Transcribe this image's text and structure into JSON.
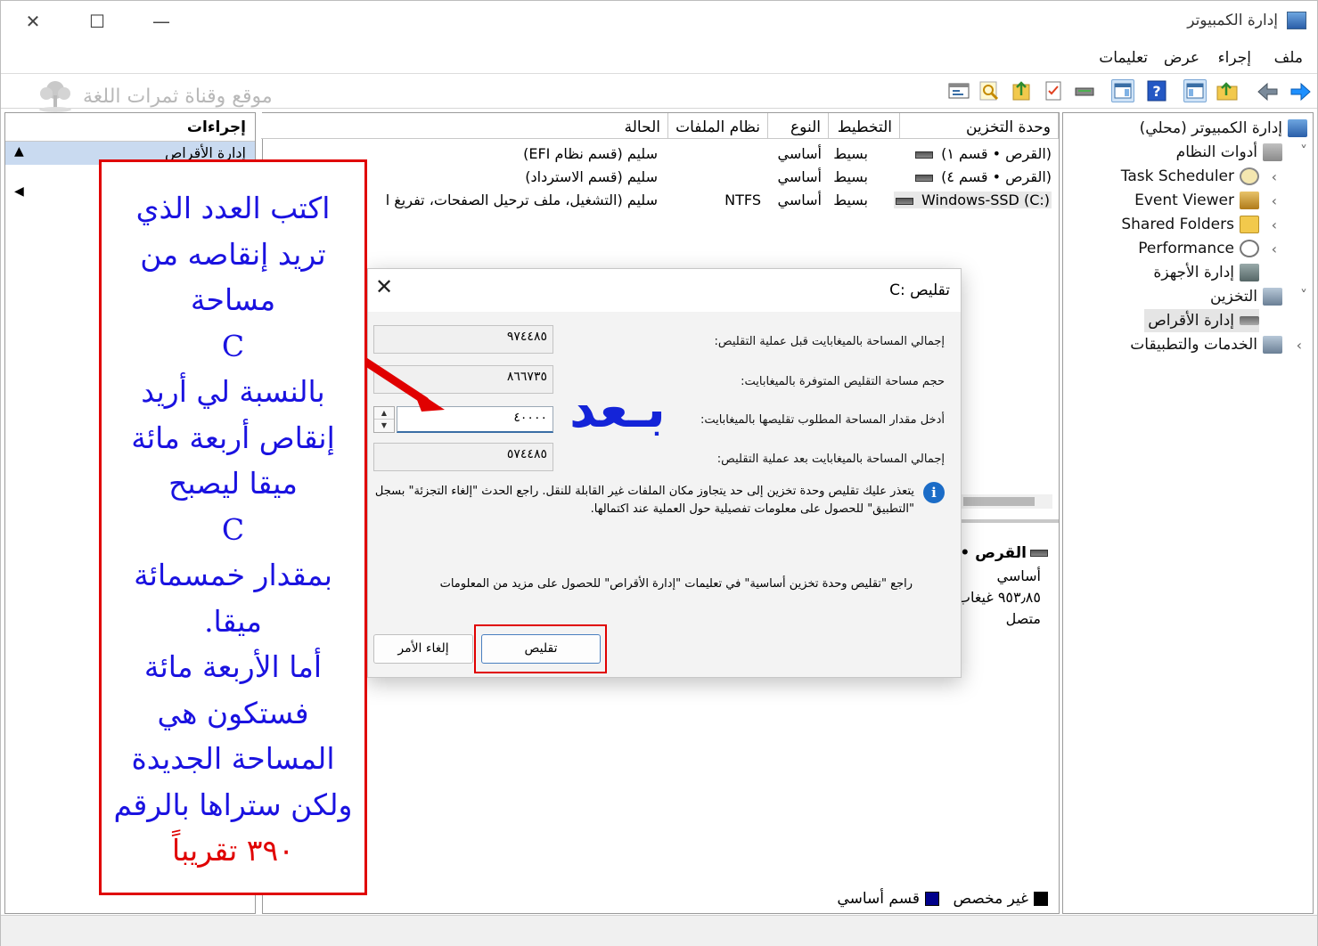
{
  "window": {
    "title": "إدارة الكمبيوتر",
    "controls": {
      "minimize": "—",
      "maximize": "☐",
      "close": "✕"
    }
  },
  "menu": [
    "ملف",
    "إجراء",
    "عرض",
    "تعليمات"
  ],
  "watermark": "موقع وقناة ثمرات اللغة",
  "tree": {
    "root": "إدارة الكمبيوتر (محلي)",
    "items": [
      {
        "label": "أدوات النظام",
        "icon": "tools-icon"
      },
      {
        "label": "Task Scheduler",
        "icon": "clock-icon"
      },
      {
        "label": "Event Viewer",
        "icon": "event-viewer-icon"
      },
      {
        "label": "Shared Folders",
        "icon": "shared-folder-icon"
      },
      {
        "label": "Performance",
        "icon": "performance-icon"
      },
      {
        "label": "إدارة الأجهزة",
        "icon": "device-manager-icon"
      },
      {
        "label": "التخزين",
        "icon": "storage-icon"
      },
      {
        "label": "إدارة الأقراص",
        "icon": "disk-management-icon"
      },
      {
        "label": "الخدمات والتطبيقات",
        "icon": "services-icon"
      }
    ]
  },
  "volumes": {
    "columns": [
      "وحدة التخزين",
      "التخطيط",
      "النوع",
      "نظام الملفات",
      "الحالة"
    ],
    "rows": [
      {
        "volume": "(القرص • قسم ١)",
        "layout": "بسيط",
        "type": "أساسي",
        "fs": "",
        "status": "سليم (قسم نظام EFI)"
      },
      {
        "volume": "(القرص • قسم ٤)",
        "layout": "بسيط",
        "type": "أساسي",
        "fs": "",
        "status": "سليم (قسم الاسترداد)"
      },
      {
        "volume": "Windows-SSD (C:)",
        "layout": "بسيط",
        "type": "أساسي",
        "fs": "NTFS",
        "status": "سليم (التشغيل، ملف ترحيل الصفحات، تفريغ ا"
      }
    ]
  },
  "disk_info": {
    "name": "القرص •",
    "type": "أساسي",
    "size": "٩٥٣٫٨٥ غيغاب",
    "status": "متصل"
  },
  "legend": {
    "unallocated": "غير مخصص",
    "primary": "قسم أساسي"
  },
  "actions": {
    "header": "إجراءات",
    "item": "إدارة الأقراص"
  },
  "dialog": {
    "title": "تقليص :C",
    "close": "✕",
    "rows": [
      {
        "label": "إجمالي المساحة بالميغابايت قبل عملية التقليص:",
        "value": "٩٧٤٤٨٥"
      },
      {
        "label": "حجم مساحة التقليص المتوفرة بالميغابايت:",
        "value": "٨٦٦٧٣٥"
      },
      {
        "label": "أدخل مقدار المساحة المطلوب تقليصها بالميغابايت:",
        "value": "٤٠٠٠٠"
      },
      {
        "label": "إجمالي المساحة بالميغابايت بعد عملية التقليص:",
        "value": "٥٧٤٤٨٥"
      }
    ],
    "info": "يتعذر عليك تقليص وحدة تخزين إلى حد يتجاوز مكان الملفات غير القابلة للنقل. راجع الحدث \"إلغاء التجزئة\" بسجل \"التطبيق\" للحصول على معلومات تفصيلية حول العملية عند اكتمالها.",
    "help": "راجع \"تقليص وحدة تخزين أساسية\" في تعليمات \"إدارة الأقراص\" للحصول على مزيد من المعلومات",
    "shrink_button": "تقليص",
    "cancel_button": "إلغاء الأمر"
  },
  "overlay": {
    "after_label": "بـعد",
    "annotation_lines": [
      "اكتب العدد الذي",
      "تريد إنقاصه من",
      "مساحة",
      "C",
      "بالنسبة لي أريد",
      "إنقاص أربعة مائة",
      "ميقا ليصبح",
      "C",
      "بمقدار خمسمائة",
      "ميقا.",
      "أما الأربعة مائة",
      "فستكون هي",
      "المساحة الجديدة",
      "ولكن ستراها بالرقم"
    ],
    "annotation_last": "٣٩٠ تقريباً"
  },
  "colors": {
    "annotation_blue": "#1a12e0",
    "annotation_red": "#e00000",
    "highlight_box": "#e00000",
    "primary_partition": "#00008b",
    "unallocated": "#000000"
  }
}
